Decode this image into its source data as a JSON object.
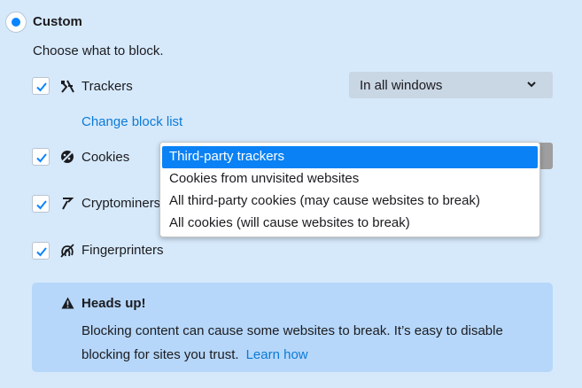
{
  "custom": {
    "title": "Custom",
    "subtitle": "Choose what to block."
  },
  "rows": [
    {
      "label": "Trackers",
      "icon": "trackers-icon",
      "checked": true
    },
    {
      "label": "Cookies",
      "icon": "cookies-icon",
      "checked": true
    },
    {
      "label": "Cryptominers",
      "icon": "cryptominers-icon",
      "checked": true
    },
    {
      "label": "Fingerprinters",
      "icon": "fingerprinters-icon",
      "checked": true
    }
  ],
  "trackers_select": {
    "value": "In all windows"
  },
  "change_block_list": "Change block list",
  "cookies_dropdown": {
    "options": [
      "Third-party trackers",
      "Cookies from unvisited websites",
      "All third-party cookies (may cause websites to break)",
      "All cookies (will cause websites to break)"
    ],
    "selected_index": 0
  },
  "notice": {
    "title": "Heads up!",
    "body": "Blocking content can cause some websites to break. It’s easy to disable blocking for sites you trust.",
    "link": "Learn how"
  },
  "colors": {
    "accent": "#0a84ff",
    "background": "#d6e9fb",
    "notice_bg": "#b6d7fa",
    "selected_bg": "#0a82f5"
  }
}
